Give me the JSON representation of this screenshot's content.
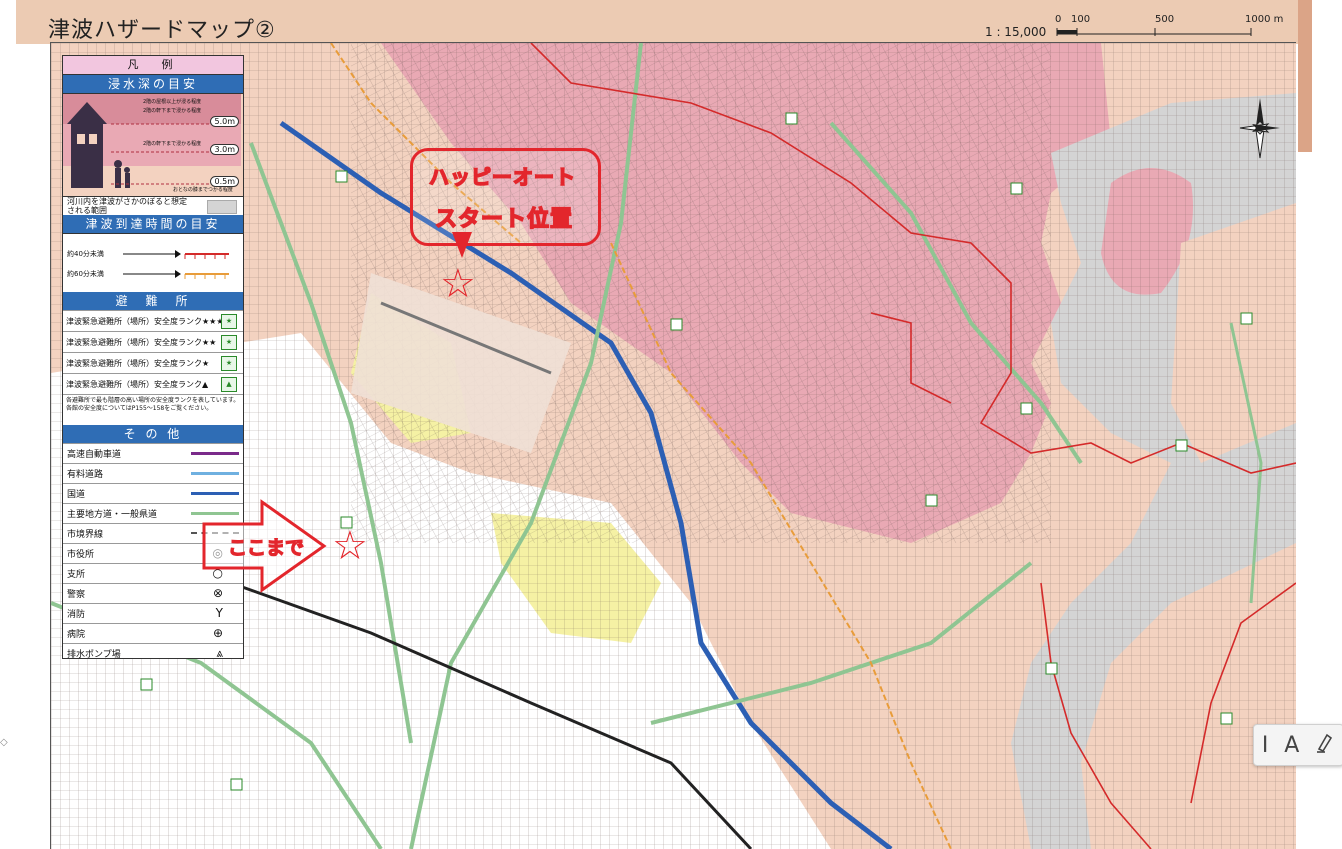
{
  "header": {
    "title": "津波ハザードマップ②",
    "scale_ratio": "1 : 15,000",
    "scale_ticks": [
      "0",
      "100",
      "500",
      "1000 m"
    ]
  },
  "legend": {
    "heading": "凡　例",
    "depth": {
      "title": "浸水深の目安",
      "levels": [
        "5.0m",
        "3.0m",
        "0.5m"
      ],
      "notes": [
        "2階の屋根以上が浸る程度",
        "2階の軒下まで浸かる程度",
        "2階の軒下まで浸かる程度",
        "おとなの膝までつかる程度"
      ],
      "river_note": "河川内を津波がさかのぼると想定される範囲"
    },
    "arrival": {
      "title": "津波到達時間の目安",
      "items": [
        "約40分未満",
        "約60分未満"
      ]
    },
    "shelters": {
      "title": "避　難　所",
      "items": [
        "津波緊急避難所（場所）安全度ランク★★★",
        "津波緊急避難所（場所）安全度ランク★★",
        "津波緊急避難所（場所）安全度ランク★",
        "津波緊急避難所（場所）安全度ランク▲"
      ],
      "note": "各避難所で最も階層の高い場所の安全度ランクを表しています。各館の安全度についてはP155～158をご覧ください。"
    },
    "other": {
      "title": "そ の 他",
      "items": [
        "高速自動車道",
        "有料道路",
        "国道",
        "主要地方道・一般県道",
        "市境界線",
        "市役所",
        "支所",
        "警察",
        "消防",
        "病院",
        "排水ポンプ場"
      ],
      "symbols": [
        "",
        "",
        "",
        "",
        "",
        "◎",
        "○",
        "⊗",
        "Y",
        "⊕",
        "⩓"
      ]
    }
  },
  "annotations": {
    "callout_lines": [
      "ハッピーオート",
      "スタート位置"
    ],
    "arrow_label": "ここまで"
  },
  "colors": {
    "flood_deep": "#e9a9b4",
    "flood_shallow": "#f3d2c0",
    "safe_yellow": "#f5f1a4",
    "road_blue": "#2c5fb4",
    "road_green": "#8fc592",
    "annotation_red": "#e3262c",
    "river_gray": "#d4d4d4"
  },
  "toolbar": {
    "cursor_icon": "text-cursor-icon",
    "text_tool": "A",
    "highlight_icon": "highlighter-icon"
  },
  "side_marker": "◇"
}
